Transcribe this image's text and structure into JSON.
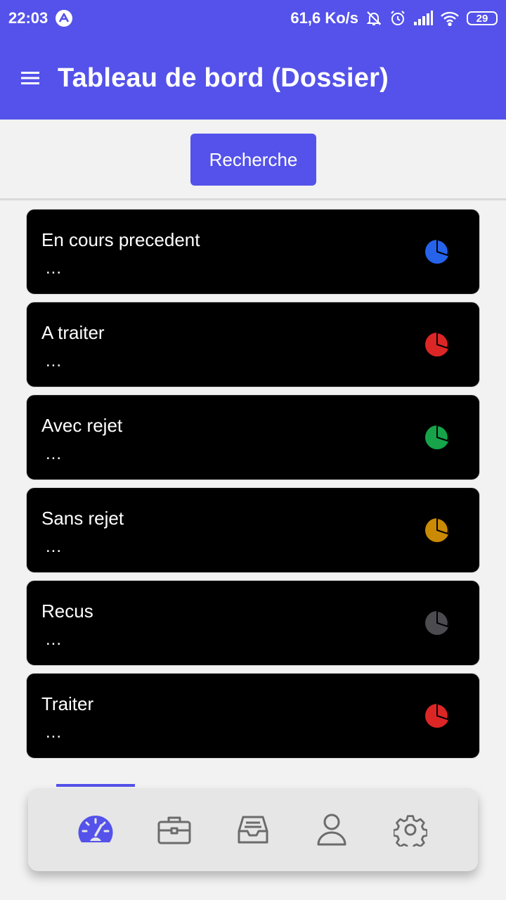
{
  "status_bar": {
    "time": "22:03",
    "network_speed": "61,6 Ko/s",
    "battery": "29",
    "icons": [
      "app-logo-icon",
      "muted-bell-icon",
      "alarm-icon",
      "signal-icon",
      "wifi-icon",
      "battery-icon"
    ]
  },
  "header": {
    "title": "Tableau de bord (Dossier)",
    "menu_icon": "hamburger-menu-icon"
  },
  "search": {
    "label": "Recherche"
  },
  "cards": [
    {
      "title": "En cours precedent",
      "value": "...",
      "icon": "pie-chart-icon",
      "color": "#2563eb"
    },
    {
      "title": "A traiter",
      "value": "...",
      "icon": "pie-chart-icon",
      "color": "#dc2626"
    },
    {
      "title": "Avec rejet",
      "value": "...",
      "icon": "pie-chart-icon",
      "color": "#16a34a"
    },
    {
      "title": "Sans rejet",
      "value": "...",
      "icon": "pie-chart-icon",
      "color": "#ca8a04"
    },
    {
      "title": "Recus",
      "value": "...",
      "icon": "pie-chart-icon",
      "color": "#4b4b50"
    },
    {
      "title": "Traiter",
      "value": "...",
      "icon": "pie-chart-icon",
      "color": "#dc2626"
    }
  ],
  "bottom_nav": {
    "items": [
      {
        "icon": "dashboard-gauge-icon",
        "active": true
      },
      {
        "icon": "briefcase-icon",
        "active": false
      },
      {
        "icon": "inbox-tray-icon",
        "active": false
      },
      {
        "icon": "user-icon",
        "active": false
      },
      {
        "icon": "settings-gear-icon",
        "active": false
      }
    ],
    "active_color": "#5452ea",
    "inactive_color": "#6b6b6b"
  },
  "colors": {
    "primary": "#5452ea",
    "background": "#f2f2f2",
    "card": "#000000"
  }
}
